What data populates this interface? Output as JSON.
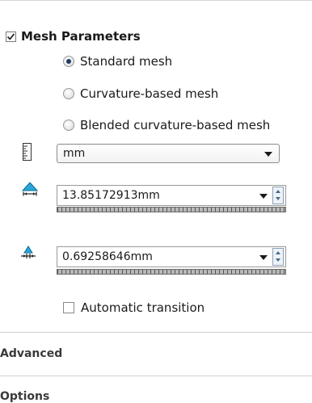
{
  "mesh_parameters": {
    "label": "Mesh Parameters",
    "checked": true,
    "mesh_types": [
      {
        "label": "Standard mesh",
        "selected": true
      },
      {
        "label": "Curvature-based mesh",
        "selected": false
      },
      {
        "label": "Blended curvature-based mesh",
        "selected": false
      }
    ],
    "unit": "mm",
    "global_size": "13.85172913mm",
    "tolerance": "0.69258646mm",
    "automatic_transition": {
      "label": "Automatic transition",
      "checked": false
    }
  },
  "sections": {
    "advanced": "Advanced",
    "options": "Options"
  }
}
